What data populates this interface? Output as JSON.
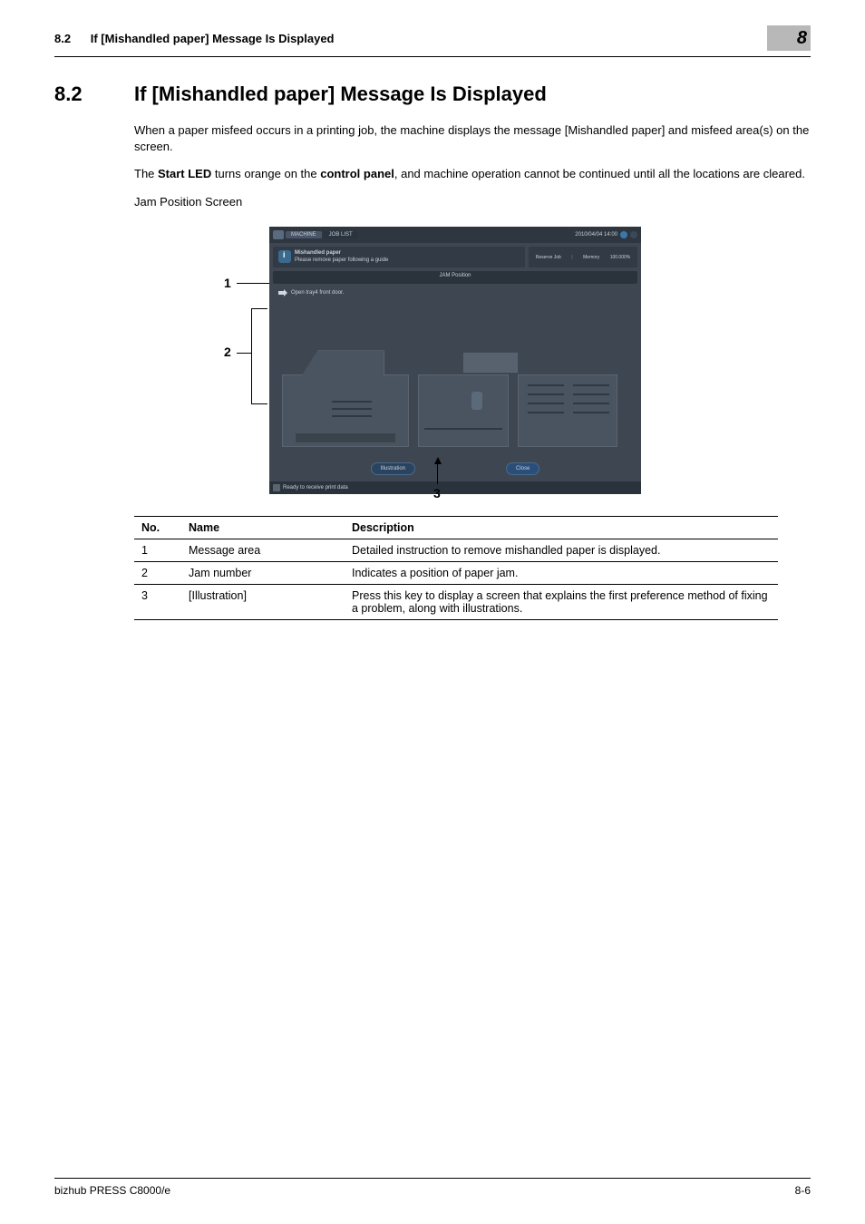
{
  "header": {
    "section_ref": "8.2",
    "section_name": "If [Mishandled paper] Message Is Displayed",
    "chapter_badge": "8"
  },
  "title": {
    "num": "8.2",
    "text": "If [Mishandled paper] Message Is Displayed"
  },
  "paragraphs": {
    "p1": "When a paper misfeed occurs in a printing job, the machine displays the message [Mishandled paper] and misfeed area(s) on the screen.",
    "p2a": "The ",
    "p2b": "Start LED",
    "p2c": " turns orange on the ",
    "p2d": "control panel",
    "p2e": ", and machine operation cannot be continued until all the locations are cleared.",
    "p3": "Jam Position Screen"
  },
  "figure": {
    "tab_machine": "MACHINE",
    "tab_joblist": "JOB LIST",
    "date": "2010/04/04  14:00",
    "msg_title": "Mishandled paper",
    "msg_sub": "Please remove paper following a guide",
    "reserve": "Reserve Job",
    "mem_label": "Memory",
    "mem_val": "100.000%",
    "strip_label": "JAM Position",
    "step1": "Open tray4 front door.",
    "btn_illustration": "Illustration",
    "btn_close": "Close",
    "footer_status": "Ready to receive print data"
  },
  "callouts": {
    "c1": "1",
    "c2": "2",
    "c3": "3"
  },
  "table": {
    "head_no": "No.",
    "head_name": "Name",
    "head_desc": "Description",
    "rows": [
      {
        "no": "1",
        "name": "Message area",
        "desc": "Detailed instruction to remove mishandled paper is displayed."
      },
      {
        "no": "2",
        "name": "Jam number",
        "desc": "Indicates a position of paper jam."
      },
      {
        "no": "3",
        "name": "[Illustration]",
        "desc": "Press this key to display a screen that explains the first preference method of fixing a problem, along with illustrations."
      }
    ]
  },
  "footer": {
    "left": "bizhub PRESS C8000/e",
    "right": "8-6"
  }
}
